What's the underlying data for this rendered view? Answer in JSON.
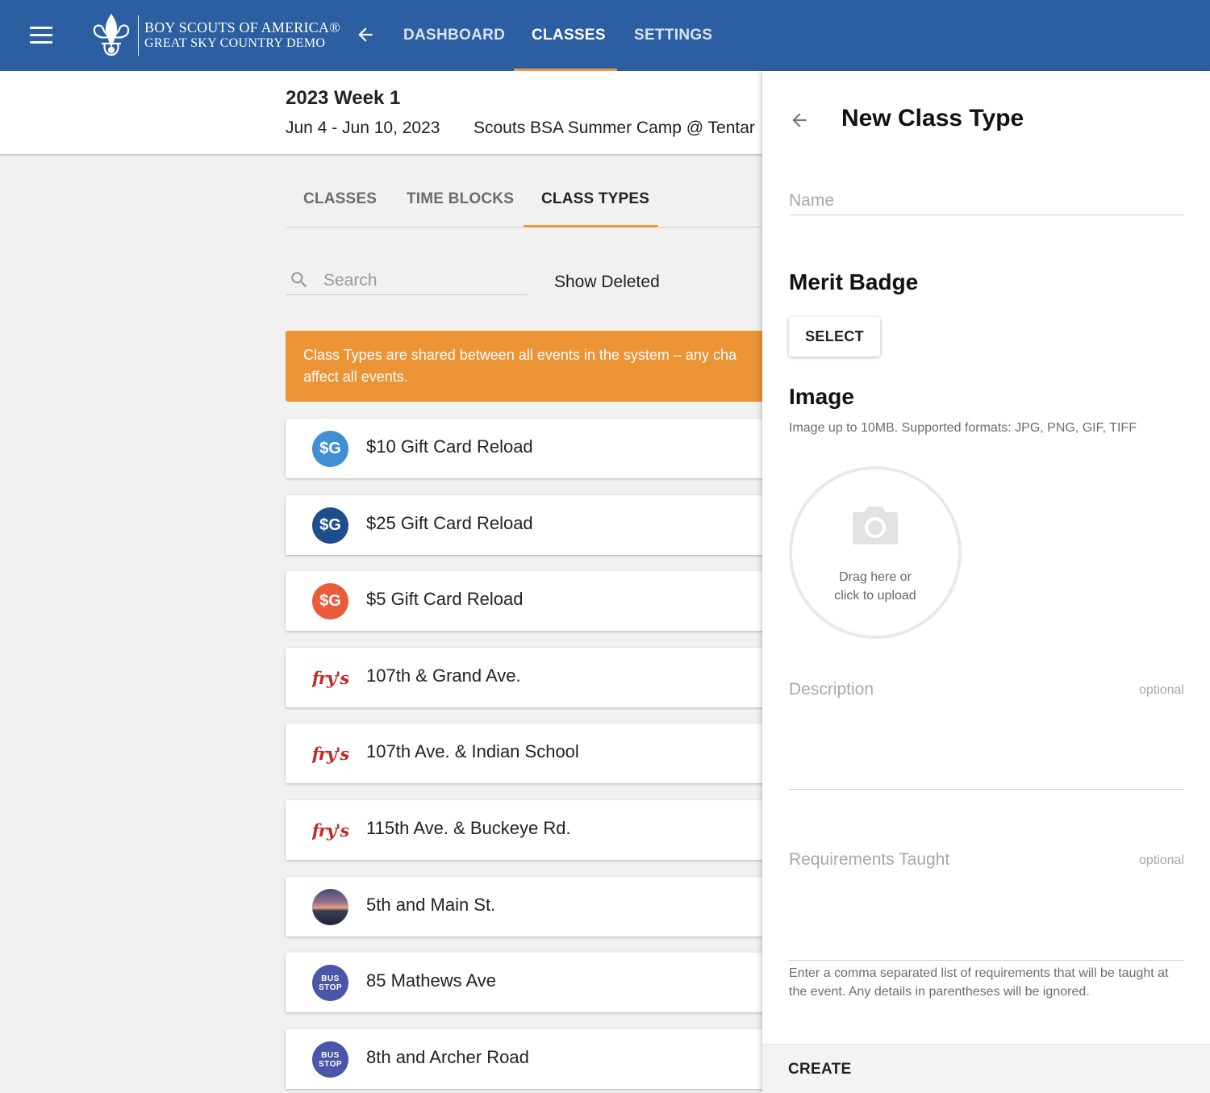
{
  "topbar": {
    "logo_line1": "BOY SCOUTS OF AMERICA®",
    "logo_line2": "GREAT SKY COUNTRY DEMO",
    "nav": [
      {
        "label": "DASHBOARD",
        "active": false
      },
      {
        "label": "CLASSES",
        "active": true
      },
      {
        "label": "SETTINGS",
        "active": false
      }
    ],
    "accent_color": "#ef9a3c",
    "bar_color": "#2c5ea2"
  },
  "event": {
    "title": "2023 Week 1",
    "dates": "Jun 4 - Jun 10, 2023",
    "location": "Scouts BSA Summer Camp @ Tentar"
  },
  "subtabs": [
    {
      "label": "CLASSES",
      "active": false
    },
    {
      "label": "TIME BLOCKS",
      "active": false
    },
    {
      "label": "CLASS TYPES",
      "active": true
    }
  ],
  "search": {
    "placeholder": "Search",
    "value": ""
  },
  "show_deleted_label": "Show Deleted",
  "banner": {
    "line1": "Class Types are shared between all events in the system – any cha",
    "line2": "affect all events."
  },
  "class_types": [
    {
      "label": "$10 Gift Card Reload",
      "icon": "sg-icon",
      "icon_text": "$G",
      "color": "#3f8fd2"
    },
    {
      "label": "$25 Gift Card Reload",
      "icon": "sg-icon",
      "icon_text": "$G",
      "color": "#1f4e8c"
    },
    {
      "label": "$5 Gift Card Reload",
      "icon": "sg-icon",
      "icon_text": "$G",
      "color": "#ea5b3c"
    },
    {
      "label": "107th & Grand Ave.",
      "icon": "frys-logo-icon",
      "icon_text": "frys"
    },
    {
      "label": "107th Ave. & Indian School",
      "icon": "frys-logo-icon",
      "icon_text": "frys"
    },
    {
      "label": "115th Ave. & Buckeye Rd.",
      "icon": "frys-logo-icon",
      "icon_text": "frys"
    },
    {
      "label": "5th and Main St.",
      "icon": "sunset-photo-icon",
      "icon_text": ""
    },
    {
      "label": "85 Mathews Ave",
      "icon": "bus-stop-icon",
      "icon_text": "BUS STOP",
      "color": "#4a57a8"
    },
    {
      "label": "8th and Archer Road",
      "icon": "bus-stop-icon",
      "icon_text": "BUS STOP",
      "color": "#4a57a8"
    }
  ],
  "panel": {
    "title": "New Class Type",
    "name_placeholder": "Name",
    "merit_badge_title": "Merit Badge",
    "select_label": "SELECT",
    "image_title": "Image",
    "image_hint": "Image up to 10MB. Supported formats: JPG, PNG, GIF, TIFF",
    "upload_line1": "Drag here or",
    "upload_line2": "click to upload",
    "description_placeholder": "Description",
    "description_optional": "optional",
    "requirements_placeholder": "Requirements Taught",
    "requirements_optional": "optional",
    "requirements_help": "Enter a comma separated list of requirements that will be taught at the event. Any details in parentheses will be ignored.",
    "create_label": "CREATE"
  }
}
